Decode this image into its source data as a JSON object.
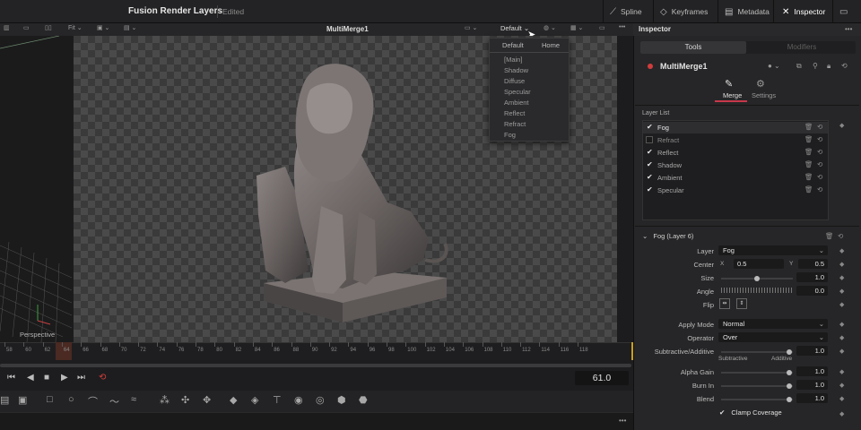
{
  "window": {
    "title": "Fusion Render Layers",
    "status": "Edited"
  },
  "topbar": {
    "buttons": [
      {
        "label": "Spline",
        "icon": "spline-icon"
      },
      {
        "label": "Keyframes",
        "icon": "keyframes-icon"
      },
      {
        "label": "Metadata",
        "icon": "metadata-icon"
      },
      {
        "label": "Inspector",
        "icon": "inspector-icon"
      }
    ]
  },
  "viewer": {
    "fit_label": "Fit",
    "node_name": "MultiMerge1",
    "channel_select": "Default",
    "perspective_label": "Perspective"
  },
  "dropdown": {
    "header_left": "Default",
    "header_right": "Home",
    "items": [
      "[Main]",
      "Shadow",
      "Diffuse",
      "Specular",
      "Ambient",
      "Reflect",
      "Refract",
      "Fog"
    ]
  },
  "timeline": {
    "ticks": [
      "58",
      "60",
      "62",
      "64",
      "66",
      "68",
      "70",
      "72",
      "74",
      "76",
      "78",
      "80",
      "82",
      "84",
      "86",
      "88",
      "90",
      "92",
      "94",
      "96",
      "98",
      "100",
      "102",
      "104",
      "106",
      "108",
      "110",
      "112",
      "114",
      "116",
      "118"
    ],
    "current_frame": "61.0"
  },
  "inspector": {
    "title": "Inspector",
    "tabs": [
      "Tools",
      "Modifiers"
    ],
    "node_name": "MultiMerge1",
    "subtabs": [
      "Merge",
      "Settings"
    ],
    "layer_list_label": "Layer List",
    "layers": [
      {
        "name": "Fog",
        "checked": true
      },
      {
        "name": "Refract",
        "checked": false
      },
      {
        "name": "Reflect",
        "checked": true
      },
      {
        "name": "Shadow",
        "checked": true
      },
      {
        "name": "Ambient",
        "checked": true
      },
      {
        "name": "Specular",
        "checked": true
      }
    ],
    "section_title": "Fog (Layer 6)",
    "params": {
      "layer_label": "Layer",
      "layer_value": "Fog",
      "center_label": "Center",
      "center_x_label": "X",
      "center_x": "0.5",
      "center_y_label": "Y",
      "center_y": "0.5",
      "size_label": "Size",
      "size_value": "1.0",
      "angle_label": "Angle",
      "angle_value": "0.0",
      "flip_label": "Flip",
      "apply_mode_label": "Apply Mode",
      "apply_mode_value": "Normal",
      "operator_label": "Operator",
      "operator_value": "Over",
      "subadd_label": "Subtractive/Additive",
      "subadd_value": "1.0",
      "subtractive_label": "Subtractive",
      "additive_label": "Additive",
      "alpha_gain_label": "Alpha Gain",
      "alpha_gain_value": "1.0",
      "burn_in_label": "Burn In",
      "burn_in_value": "1.0",
      "blend_label": "Blend",
      "blend_value": "1.0",
      "clamp_label": "Clamp Coverage"
    }
  },
  "colors": {
    "accent": "#c8384a",
    "node_dot": "#d23c3c",
    "background": "#1c1c1e"
  }
}
